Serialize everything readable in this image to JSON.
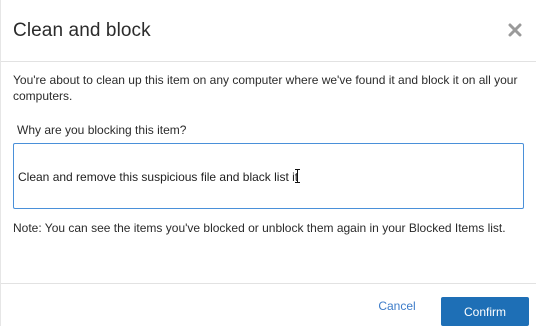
{
  "dialog": {
    "title": "Clean and block",
    "intro": "You're about to clean up this item on any computer where we've found it and block it on all your computers.",
    "question": "Why are you blocking this item?",
    "reason_value": "Clean and remove this suspicious file and black list it",
    "note": "Note: You can see the items you've blocked or unblock them again in your Blocked Items list.",
    "cancel_label": "Cancel",
    "confirm_label": "Confirm"
  },
  "icons": {
    "close": "close-icon",
    "text_cursor": "text-cursor-icon"
  },
  "colors": {
    "primary": "#1e6fb6",
    "link": "#3d7cc9",
    "focus_border": "#4a90d9",
    "close_icon": "#9a9a9a"
  }
}
